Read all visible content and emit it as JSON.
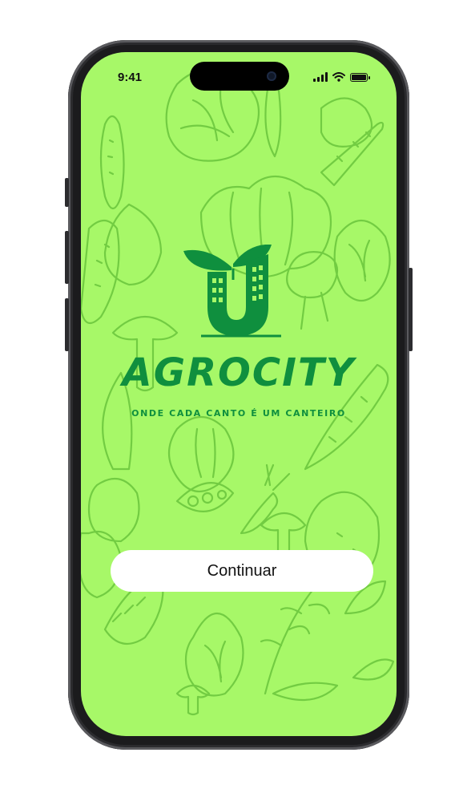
{
  "status_bar": {
    "time": "9:41"
  },
  "brand": {
    "name": "AGROCITY",
    "tagline": "ONDE CADA CANTO É UM CANTEIRO"
  },
  "actions": {
    "continue_label": "Continuar"
  },
  "colors": {
    "background": "#a7f868",
    "pattern": "#6fc93f",
    "brand": "#0f8f3e",
    "button": "#ffffff"
  },
  "icons": [
    "cellular-signal-icon",
    "wifi-icon",
    "battery-icon",
    "agrocity-logo"
  ]
}
